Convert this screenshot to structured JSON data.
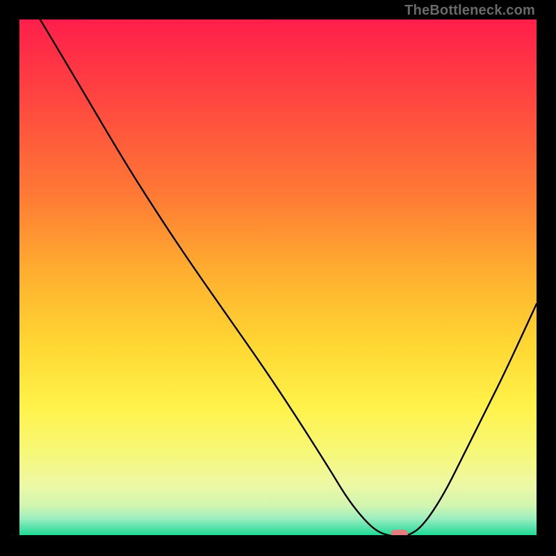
{
  "watermark": "TheBottleneck.com",
  "chart_data": {
    "type": "line",
    "title": "",
    "xlabel": "",
    "ylabel": "",
    "xlim": [
      0,
      100
    ],
    "ylim": [
      0,
      100
    ],
    "series": [
      {
        "name": "bottleneck-curve",
        "x": [
          4,
          10,
          20,
          27,
          33,
          40,
          47,
          53,
          60,
          63,
          66,
          69,
          72,
          75,
          78,
          82,
          86,
          90,
          94,
          100
        ],
        "y": [
          100,
          90,
          73,
          62,
          53,
          43,
          33,
          24,
          13,
          8,
          4,
          1,
          0,
          0,
          2,
          8,
          16,
          24,
          32,
          45
        ]
      }
    ],
    "marker": {
      "x": 73.5,
      "y": 0.5
    },
    "gradient_stops": [
      {
        "offset": 0.0,
        "color": "#ff1e4b"
      },
      {
        "offset": 0.17,
        "color": "#ff4a3f"
      },
      {
        "offset": 0.34,
        "color": "#ff7a35"
      },
      {
        "offset": 0.5,
        "color": "#ffb22f"
      },
      {
        "offset": 0.63,
        "color": "#ffd733"
      },
      {
        "offset": 0.75,
        "color": "#fff24a"
      },
      {
        "offset": 0.84,
        "color": "#f6f87a"
      },
      {
        "offset": 0.9,
        "color": "#edf8a5"
      },
      {
        "offset": 0.94,
        "color": "#d2f5b0"
      },
      {
        "offset": 0.965,
        "color": "#9ceec0"
      },
      {
        "offset": 0.985,
        "color": "#4fe0a8"
      },
      {
        "offset": 1.0,
        "color": "#16d98e"
      }
    ]
  }
}
